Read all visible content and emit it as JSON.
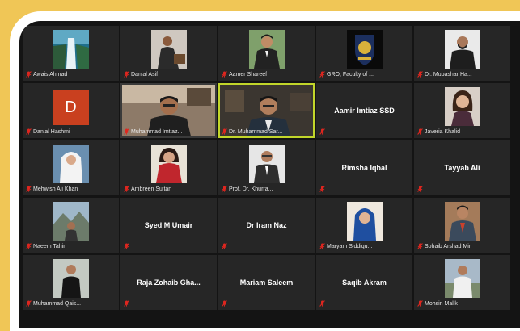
{
  "participants": [
    {
      "name": "Awais Ahmad",
      "type": "photo",
      "photo": "waterfall"
    },
    {
      "name": "Danial Asif",
      "type": "photo",
      "photo": "man-sitting"
    },
    {
      "name": "Aamer Shareef",
      "type": "photo",
      "photo": "man-suit-outdoor"
    },
    {
      "name": "GRO, Faculty of ...",
      "type": "photo",
      "photo": "logo-emblem"
    },
    {
      "name": "Dr. Mubashar Ha...",
      "type": "photo",
      "photo": "man-beard-suit"
    },
    {
      "name": "Danial Hashmi",
      "type": "initial",
      "initial": "D"
    },
    {
      "name": "Muhammad Imtiaz...",
      "type": "video",
      "photo": "man-glasses-room"
    },
    {
      "name": "Dr. Muhammad Sar...",
      "type": "video",
      "photo": "man-office",
      "active": true
    },
    {
      "name": "Aamir Imtiaz SSD",
      "type": "text"
    },
    {
      "name": "Javeria Khalid",
      "type": "photo",
      "photo": "woman-portrait"
    },
    {
      "name": "Mehwish Ali Khan",
      "type": "photo",
      "photo": "woman-hijab-white"
    },
    {
      "name": "Ambreen Sultan",
      "type": "photo",
      "photo": "woman-red"
    },
    {
      "name": "Prof. Dr. Khurra...",
      "type": "photo",
      "photo": "man-glasses-suit"
    },
    {
      "name": "Rimsha Iqbal",
      "type": "text"
    },
    {
      "name": "Tayyab Ali",
      "type": "text"
    },
    {
      "name": "Naeem Tahir",
      "type": "photo",
      "photo": "mountain-man"
    },
    {
      "name": "Syed M Umair",
      "type": "text"
    },
    {
      "name": "Dr Iram Naz",
      "type": "text"
    },
    {
      "name": "Maryam Siddiqu...",
      "type": "photo",
      "photo": "woman-blue-scarf"
    },
    {
      "name": "Sohaib Arshad Mir",
      "type": "photo",
      "photo": "man-blazer"
    },
    {
      "name": "Muhammad Qais...",
      "type": "photo",
      "photo": "man-black-suit"
    },
    {
      "name": "Raja Zohaib Gha...",
      "type": "text"
    },
    {
      "name": "Mariam Saleem",
      "type": "text"
    },
    {
      "name": "Saqib Akram",
      "type": "text"
    },
    {
      "name": "Mohsin Malik",
      "type": "photo",
      "photo": "man-white-outdoor"
    }
  ],
  "colors": {
    "background": "#f0c656",
    "frame": "#ffffff",
    "gallery": "#141414",
    "tile": "#262626",
    "active_border": "#c2d62a",
    "mute_icon": "#e0261f"
  }
}
